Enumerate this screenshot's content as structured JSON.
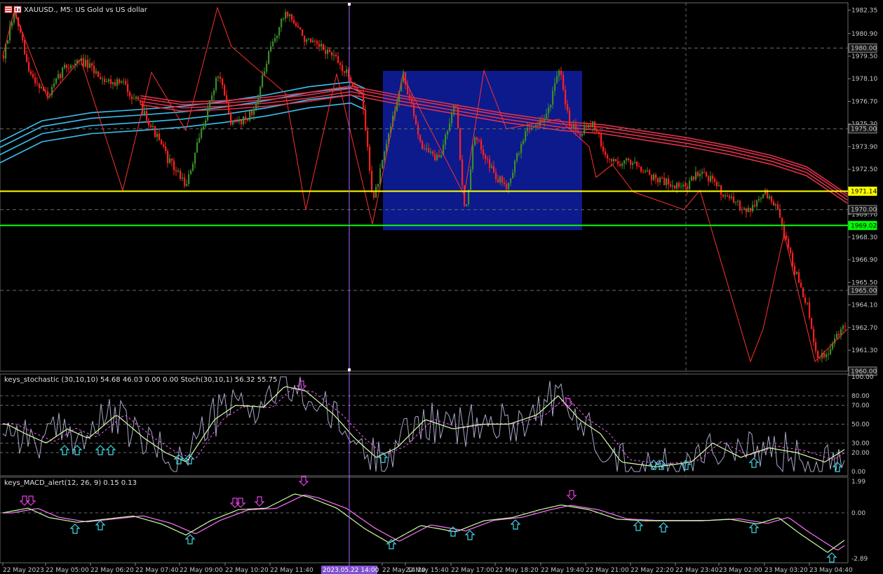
{
  "header": {
    "symbol": "XAUUSD., M5:  US Gold vs US dollar"
  },
  "price_axis": {
    "ticks": [
      "1982.35",
      "1980.90",
      "1979.50",
      "1978.10",
      "1976.70",
      "1975.30",
      "1973.90",
      "1972.50",
      "1969.70",
      "1968.30",
      "1966.90",
      "1965.50",
      "1964.10",
      "1962.70",
      "1961.30"
    ],
    "ylim": [
      1960.0,
      1982.8
    ]
  },
  "level_tags": [
    {
      "value": 1980.0,
      "label": "1980.00",
      "color": "#1a1a1a",
      "text": "#c8c8c8",
      "line": "dashed"
    },
    {
      "value": 1975.0,
      "label": "1975.00",
      "color": "#1a1a1a",
      "text": "#c8c8c8",
      "line": "dashed"
    },
    {
      "value": 1971.14,
      "label": "1971.14",
      "color": "#ffff00",
      "text": "#000000",
      "line": "solid-yellow"
    },
    {
      "value": 1970.0,
      "label": "1970.00",
      "color": "#1a1a1a",
      "text": "#c8c8c8",
      "line": "dashed"
    },
    {
      "value": 1969.02,
      "label": "1969.02",
      "color": "#00ff00",
      "text": "#000000",
      "line": "solid-green"
    },
    {
      "value": 1965.0,
      "label": "1965.00",
      "color": "#1a1a1a",
      "text": "#c8c8c8",
      "line": "dashed"
    },
    {
      "value": 1960.0,
      "label": "1960.00",
      "color": "#1a1a1a",
      "text": "#c8c8c8",
      "line": "none"
    }
  ],
  "stochastic": {
    "label": "keys_stochastic (30,10,10) 54.68 46.03 0.00 0.00 Stoch(30,10,1) 56.32 55.75",
    "ticks": [
      "100.00",
      "80.00",
      "70.00",
      "50.00",
      "30.00",
      "20.00",
      "0.00"
    ],
    "levels": [
      100,
      80,
      70,
      50,
      30,
      20,
      0
    ]
  },
  "macd": {
    "label": "keys_MACD_alert(12, 26, 9) 0.15 0.13",
    "ticks": [
      "1.99",
      "0.00",
      "-2.89"
    ],
    "ylim": [
      -2.89,
      1.99
    ]
  },
  "time_axis": {
    "labels": [
      "22 May 2023",
      "22 May 05:00",
      "22 May 06:20",
      "22 May 07:40",
      "22 May 09:00",
      "22 May 10:20",
      "22 May 11:40",
      "22 May 14:20",
      "22 May 15:40",
      "22 May 17:00",
      "22 May 18:20",
      "22 May 19:40",
      "22 May 21:00",
      "22 May 22:20",
      "22 May 23:40",
      "23 May 02:00",
      "23 May 03:20",
      "23 May 04:40"
    ],
    "highlight": "2023.05.22 14:00"
  },
  "colors": {
    "background": "#000000",
    "bull": "#3c8c2a",
    "bear": "#ff2020",
    "ma_blue": "#3cc0f0",
    "ma_red": "#e0304a",
    "zone": "#0c1a8c",
    "zigzag": "#ff3030",
    "crosshair": "#b060ff",
    "stoch_main": "#a8a8c8",
    "stoch_signal": "#d8ffb0",
    "stoch_dashed": "#ff60ff",
    "macd_main": "#c8ffa0",
    "macd_signal": "#ff70ff",
    "arrow_up": "#40d8e8",
    "arrow_down": "#e040e0"
  },
  "chart_data": {
    "type": "candlestick",
    "title": "XAUUSD., M5:  US Gold vs US dollar",
    "ylim": [
      1960.0,
      1982.8
    ],
    "zigzag": [
      1979.5,
      1982.3,
      1976.9,
      1979.3,
      1971.2,
      1978.5,
      1974.9,
      1982.5,
      1980.1,
      1977.2,
      1970.0,
      1978.4,
      1969.1,
      1978.3,
      1970.9,
      1978.6,
      1975.0,
      1975.6,
      1973.9,
      1972.0,
      1972.8,
      1971.1,
      1970.0,
      1971.2,
      1960.6,
      1962.6
    ],
    "series": [
      {
        "name": "XAUUSD.",
        "values": [
          1979.5,
          1982.3,
          1977.4,
          1978.9,
          1978.3,
          1978.2,
          1975.6,
          1971.6,
          1974.7,
          1978.4,
          1975.2,
          1976.1,
          1980.0,
          1982.4,
          1980.4,
          1979.6,
          1977.1,
          1970.5,
          1976.0,
          1978.3,
          1970.3,
          1975.1,
          1969.1,
          1974.3,
          1972.1,
          1977.8,
          1974.9,
          1975.4,
          1973.9,
          1972.3,
          1972.7,
          1971.5,
          1971.9,
          1970.3,
          1971.0,
          1964.8,
          1961.0,
          1963.0
        ]
      }
    ]
  }
}
